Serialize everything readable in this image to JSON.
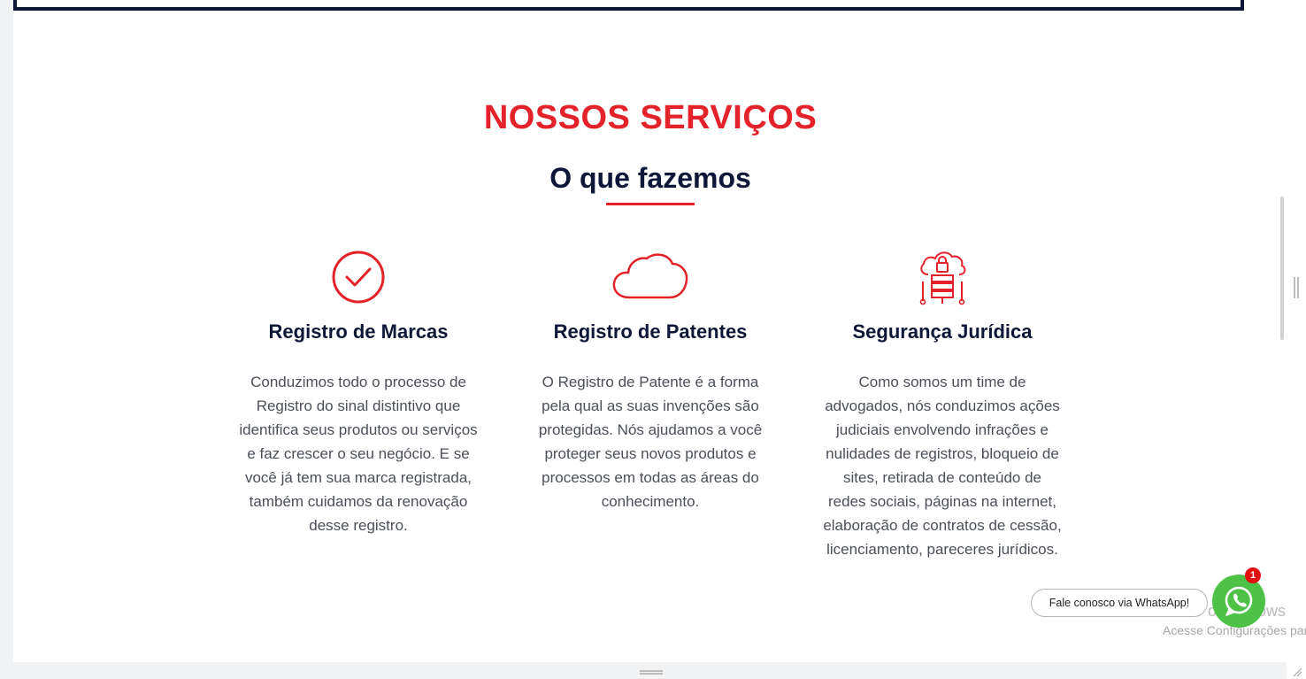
{
  "section": {
    "kicker": "NOSSOS SERVIÇOS",
    "heading": "O que fazemos"
  },
  "services": [
    {
      "title": "Registro de Marcas",
      "description": "Conduzimos todo o processo de Registro do sinal distintivo que identifica seus produtos ou serviços e faz crescer o seu negócio. E se você já tem sua marca registrada, também cuidamos da renovação desse registro.",
      "icon": "check-circle-icon"
    },
    {
      "title": "Registro de Patentes",
      "description": "O Registro de Patente é a forma pela qual as suas invenções são protegidas. Nós ajudamos a você proteger seus novos produtos e processos em todas as áreas do conhecimento.",
      "icon": "cloud-icon"
    },
    {
      "title": "Segurança Jurídica",
      "description": "Como somos um time de advogados, nós conduzimos ações judiciais envolvendo infrações e nulidades de registros, bloqueio de sites, retirada de conteúdo de redes sociais, páginas na internet, elaboração de contratos de cessão, licenciamento, pareceres jurídicos.",
      "icon": "secure-server-icon"
    }
  ],
  "whatsapp": {
    "label": "Fale conosco via WhatsApp!",
    "badge": "1",
    "icon": "whatsapp-icon"
  },
  "windows_watermark": {
    "title": "Ativar o Windows",
    "subtitle": "Acesse Configurações para"
  },
  "colors": {
    "accent": "#e32229",
    "navy": "#0e1738",
    "whatsapp": "#4dc247"
  }
}
